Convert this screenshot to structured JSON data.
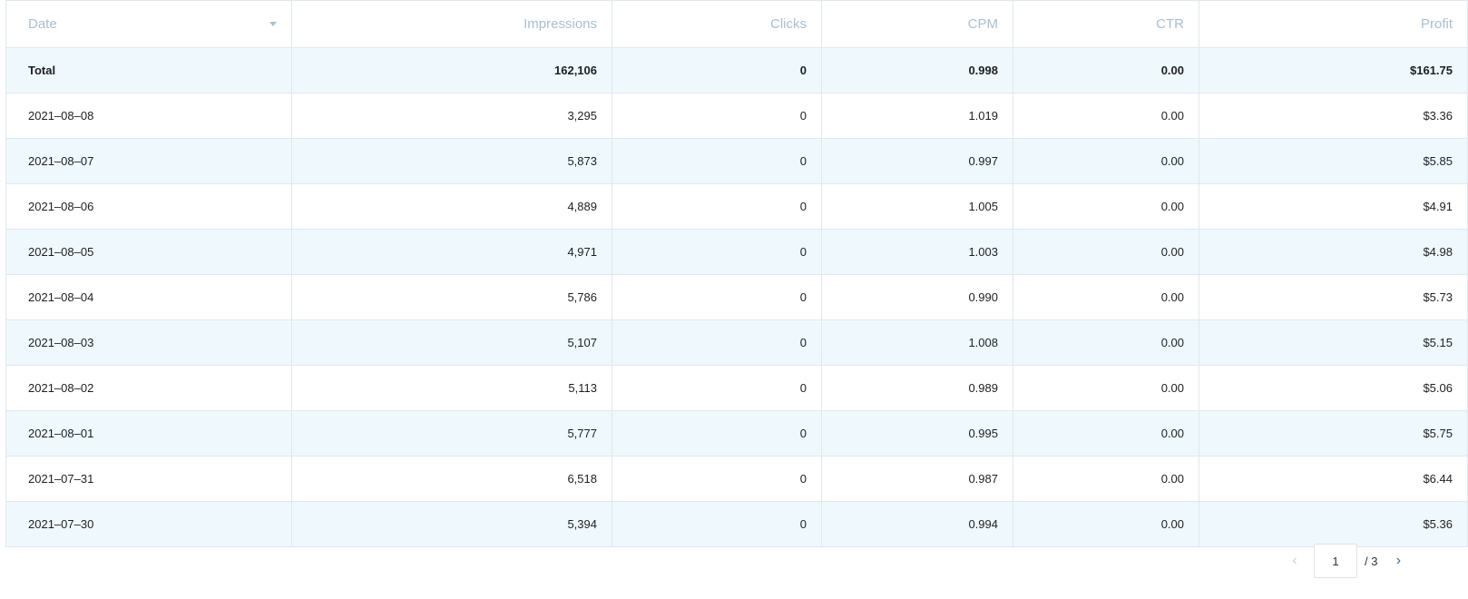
{
  "columns": [
    {
      "label": "Date",
      "align": "left"
    },
    {
      "label": "Impressions",
      "align": "right"
    },
    {
      "label": "Clicks",
      "align": "right"
    },
    {
      "label": "CPM",
      "align": "right"
    },
    {
      "label": "CTR",
      "align": "right"
    },
    {
      "label": "Profit",
      "align": "right"
    }
  ],
  "total": {
    "date": "Total",
    "impressions": "162,106",
    "clicks": "0",
    "cpm": "0.998",
    "ctr": "0.00",
    "profit": "$161.75"
  },
  "rows": [
    {
      "date": "2021–08–08",
      "impressions": "3,295",
      "clicks": "0",
      "cpm": "1.019",
      "ctr": "0.00",
      "profit": "$3.36"
    },
    {
      "date": "2021–08–07",
      "impressions": "5,873",
      "clicks": "0",
      "cpm": "0.997",
      "ctr": "0.00",
      "profit": "$5.85"
    },
    {
      "date": "2021–08–06",
      "impressions": "4,889",
      "clicks": "0",
      "cpm": "1.005",
      "ctr": "0.00",
      "profit": "$4.91"
    },
    {
      "date": "2021–08–05",
      "impressions": "4,971",
      "clicks": "0",
      "cpm": "1.003",
      "ctr": "0.00",
      "profit": "$4.98"
    },
    {
      "date": "2021–08–04",
      "impressions": "5,786",
      "clicks": "0",
      "cpm": "0.990",
      "ctr": "0.00",
      "profit": "$5.73"
    },
    {
      "date": "2021–08–03",
      "impressions": "5,107",
      "clicks": "0",
      "cpm": "1.008",
      "ctr": "0.00",
      "profit": "$5.15"
    },
    {
      "date": "2021–08–02",
      "impressions": "5,113",
      "clicks": "0",
      "cpm": "0.989",
      "ctr": "0.00",
      "profit": "$5.06"
    },
    {
      "date": "2021–08–01",
      "impressions": "5,777",
      "clicks": "0",
      "cpm": "0.995",
      "ctr": "0.00",
      "profit": "$5.75"
    },
    {
      "date": "2021–07–31",
      "impressions": "6,518",
      "clicks": "0",
      "cpm": "0.987",
      "ctr": "0.00",
      "profit": "$6.44"
    },
    {
      "date": "2021–07–30",
      "impressions": "5,394",
      "clicks": "0",
      "cpm": "0.994",
      "ctr": "0.00",
      "profit": "$5.36"
    }
  ],
  "pagination": {
    "prev_icon": "chevron-left-icon",
    "next_icon": "chevron-right-icon",
    "current_page": "1",
    "total_label": "/ 3"
  },
  "colors": {
    "header_text": "#a9bfcf",
    "row_shade": "#eef8fd",
    "border": "#dfe8ee",
    "next_arrow": "#3a6f96"
  }
}
